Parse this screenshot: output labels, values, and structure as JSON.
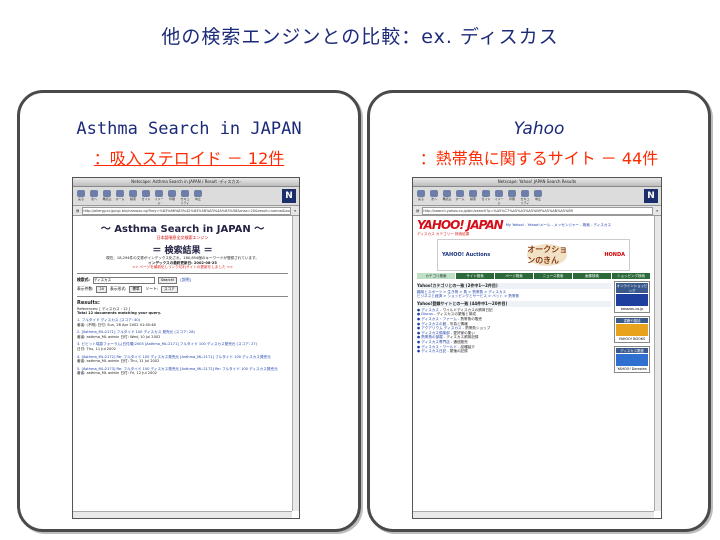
{
  "slide": {
    "title": "他の検索エンジンとの比較：ex. ディスカス"
  },
  "left_panel": {
    "heading": "Asthma Search in JAPAN",
    "caption": "：吸入ステロイド － 12件",
    "browser": {
      "window_title": "Netscape: Asthma Search in JAPAN / Result -ディスカス-",
      "url": "http://allergy.or.jp/cgi-bin/namazu.cgi?key=%83%66%83%42%83%58%83%4A%83%58&max=20&result=normal&sort=score",
      "toolbar": [
        "戻る",
        "次へ",
        "再読込",
        "ホーム",
        "検索",
        "ガイド",
        "イメージ",
        "印刷",
        "セキュリティ",
        "中止"
      ],
      "page": {
        "banner": "～ Asthma Search in JAPAN ～",
        "banner_sub": "日本語喘息全文検索エンジン",
        "results_heading": "＝ 検索結果 ＝",
        "index_note": "現在、18,294件の文書がインデックス化され、180,854個のキーワードが登録されています。",
        "index_date": "インデックスの最終更新日: 2002-08-25",
        "notice": ">> ページを最新化しリンク切れサイトの更新をしました <<",
        "query_label": "検索式:",
        "query_value": "ディスカス",
        "search_button": "Search!",
        "help_link": "[説明]",
        "count_label": "表示件数:",
        "count_value": "20",
        "format_label": "表示形式:",
        "format_value": "標準",
        "sort_label": "ソート:",
        "sort_value": "スコア",
        "results_label": "Results:",
        "references": "References: [ ディスカス : 12 ]",
        "total": "Total 12 documents matching your query.",
        "results": [
          {
            "title": "1. フルタイド ディスカス (スコア: 40)",
            "meta": "著者: (不明)  日付: Sun, 28 Apr 2002 01:40:48"
          },
          {
            "title": "2. [Asthma_ML:2171] フルタイド 100 ディスカス 発売元 (スコア: 28)",
            "meta": "著者: asthma_ML admin  日付: Wed, 10 Jul 2002"
          },
          {
            "title": "3. ビビット喘息フォーラム(日付順)2005 [Asthma_ML:2171] フルタイド 100 ディスカス発売元 (スコア: 27)",
            "meta": "日付: Thu, 11 Jul 2002"
          },
          {
            "title": "4. [Asthma_ML:2172] Re: フルタイド 100 ディスカス発売元 [Asthma_ML:2171] フルタイド 100 ディスカス発売元",
            "meta": "著者: asthma_ML admin  日付: Thu, 11 Jul 2002"
          },
          {
            "title": "5. [Asthma_ML:2173] Re: フルタイド 100 ディスカス発売元 [Asthma_ML:2172] Re: フルタイド 100 ディスカス発売元",
            "meta": "著者: asthma_ML admin  日付: Fri, 12 Jul 2002"
          }
        ]
      }
    }
  },
  "right_panel": {
    "heading": "Yahoo",
    "caption": "：熱帯魚に関するサイト － 44件",
    "browser": {
      "window_title": "Netscape: Yahoo! JAPAN Search Results",
      "url": "http://search.yahoo.co.jp/bin/search?p=%A5%C7%A5%A3%A5%B9%A5%AB%A5%B9",
      "toolbar": [
        "戻る",
        "次へ",
        "再読込",
        "ホーム",
        "検索",
        "ガイド",
        "イメージ",
        "印刷",
        "セキュリティ",
        "中止"
      ],
      "page": {
        "logo": "YAHOO! JAPAN",
        "top_links": "My Yahoo! - Yahoo!メール - メッセンジャー - 検索 - ディスカス",
        "ad_line": "ディスカス カテゴリー 検索結果",
        "ad_auction": "YAHOO! Auctions",
        "ad_kin": "オークションのきん",
        "ad_honda": "HONDA",
        "tabs": [
          "カテゴリ検索",
          "サイト検索",
          "ページ検索",
          "ニュース検索",
          "画像検索",
          "ショッピング検索"
        ],
        "section1": "Yahoo!カテゴリとの一致 (2件中1～2件目)",
        "section2": "Yahoo!登録サイトとの一致 (44件中1～20件目)",
        "side": [
          "オンラインショッピング",
          "amazon.co.jp",
          "書籍や雑誌",
          "YAHOO! BOOKS",
          "ディスカス関連",
          "YAHOO! Domains"
        ]
      }
    }
  }
}
